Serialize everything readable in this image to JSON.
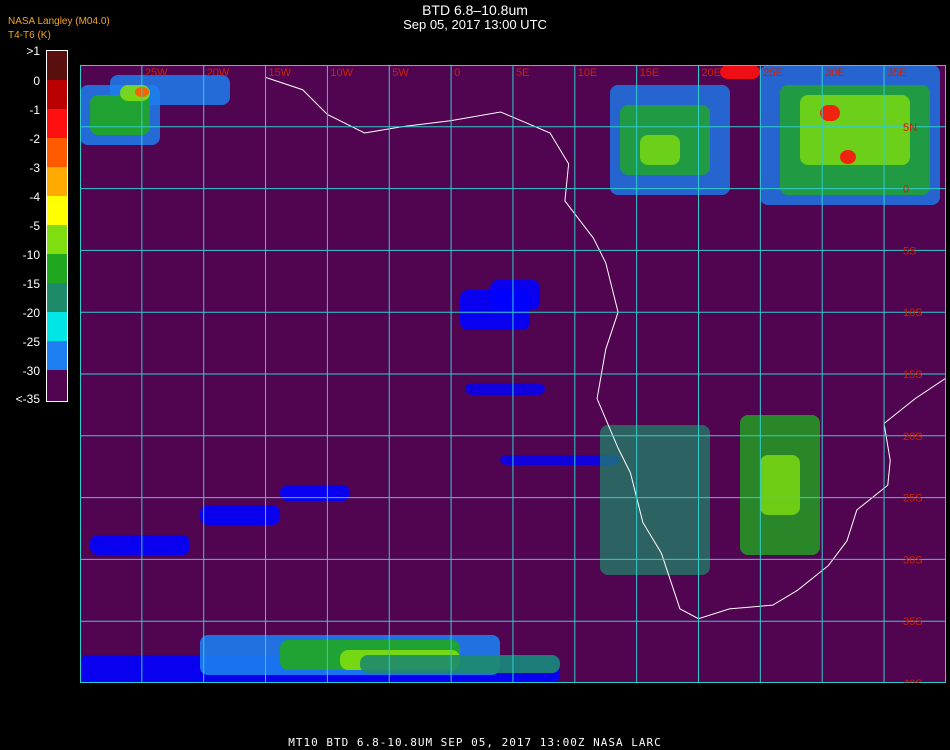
{
  "header": {
    "title": "BTD 6.8–10.8um",
    "subtitle": "Sep 05, 2017 13:00 UTC",
    "credit_line1": "NASA Langley (M04.0)",
    "credit_line2": "T4-T6 (K)"
  },
  "legend": {
    "items": [
      {
        "label": ">1",
        "color": "#5a0f0f"
      },
      {
        "label": "0",
        "color": "#b80000"
      },
      {
        "label": "-1",
        "color": "#ff1010"
      },
      {
        "label": "-2",
        "color": "#ff5a00"
      },
      {
        "label": "-3",
        "color": "#ffaa00"
      },
      {
        "label": "-4",
        "color": "#ffff00"
      },
      {
        "label": "-5",
        "color": "#80dd10"
      },
      {
        "label": "-10",
        "color": "#1fa81f"
      },
      {
        "label": "-15",
        "color": "#1e8a6a"
      },
      {
        "label": "-20",
        "color": "#00e5e5"
      },
      {
        "label": "-25",
        "color": "#1c7ef0"
      },
      {
        "label": "-30",
        "color": "#0000ff"
      },
      {
        "label": "<-35",
        "color": "#510450"
      }
    ]
  },
  "map": {
    "lon_labels": [
      "25W",
      "20W",
      "15W",
      "10W",
      "5W",
      "0",
      "5E",
      "10E",
      "15E",
      "20E",
      "25E",
      "30E",
      "35E"
    ],
    "lat_labels": [
      "5N",
      "0",
      "5S",
      "10S",
      "15S",
      "20S",
      "25S",
      "30S",
      "35S",
      "40S"
    ],
    "grid_color": "#33cccc",
    "label_color": "#cc2200",
    "coast_color": "#ffffff",
    "background_color": "#510450"
  },
  "footer": {
    "text": "MT10  BTD 6.8-10.8UM   SEP 05, 2017 13:00Z   NASA LARC"
  }
}
